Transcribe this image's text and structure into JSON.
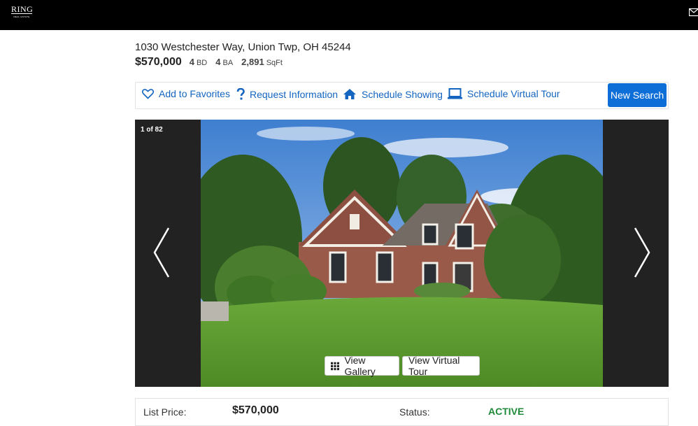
{
  "header": {
    "logo_main": "RING",
    "logo_sub": "REAL ESTATE",
    "mail_icon": "envelope-icon"
  },
  "listing": {
    "address": "1030 Westchester Way, Union Twp, OH 45244",
    "price": "$570,000",
    "beds": "4",
    "beds_unit": "BD",
    "baths": "4",
    "baths_unit": "BA",
    "sqft": "2,891",
    "sqft_unit": "SqFt"
  },
  "actions": {
    "favorites": "Add to Favorites",
    "request_info": "Request Information",
    "schedule_showing": "Schedule Showing",
    "schedule_virtual_tour": "Schedule Virtual Tour",
    "new_search": "New Search"
  },
  "gallery": {
    "counter": "1 of 82",
    "view_gallery": "View Gallery",
    "view_virtual_tour": "View Virtual Tour"
  },
  "details": {
    "list_price_label": "List Price:",
    "list_price_value": "$570,000",
    "status_label": "Status:",
    "status_value": "ACTIVE"
  },
  "colors": {
    "accent": "#1465c0",
    "button": "#0d6ed8",
    "status_active": "#1f8a3a",
    "topbar": "#000000"
  }
}
